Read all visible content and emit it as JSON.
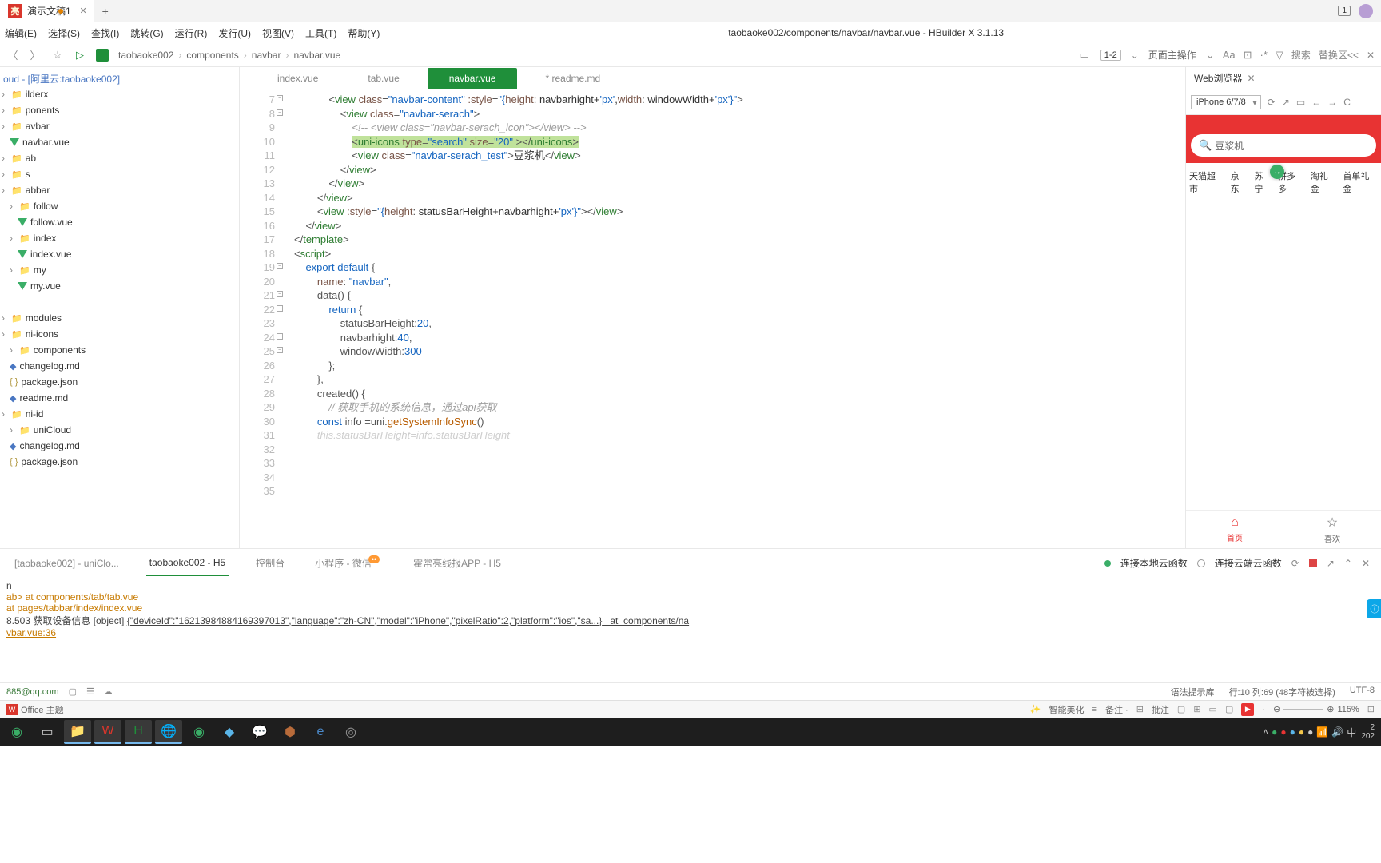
{
  "browser": {
    "tab_label": "演示文稿1",
    "tab_count": "1"
  },
  "menus": [
    "编辑(E)",
    "选择(S)",
    "查找(I)",
    "跳转(G)",
    "运行(R)",
    "发行(U)",
    "视图(V)",
    "工具(T)",
    "帮助(Y)"
  ],
  "window_title": "taobaoke002/components/navbar/navbar.vue - HBuilder X 3.1.13",
  "toolbar": {
    "ln_range": "1-2",
    "page_action": "页面主操作",
    "search_label": "搜索",
    "replace_label": "替换区<<"
  },
  "breadcrumbs": [
    "taobaoke002",
    "components",
    "navbar",
    "navbar.vue"
  ],
  "sidebar": {
    "project_suffix": "oud - [阿里云:taobaoke002]",
    "items": [
      {
        "pad": 0,
        "type": "folder",
        "label": "ilderx"
      },
      {
        "pad": 0,
        "type": "folder",
        "label": "ponents"
      },
      {
        "pad": 0,
        "type": "folder",
        "label": "avbar"
      },
      {
        "pad": 10,
        "type": "vue",
        "label": "navbar.vue"
      },
      {
        "pad": 0,
        "type": "folder",
        "label": "ab"
      },
      {
        "pad": 0,
        "type": "folder",
        "label": "s"
      },
      {
        "pad": 0,
        "type": "folder",
        "label": "abbar"
      },
      {
        "pad": 10,
        "type": "folder",
        "label": "follow"
      },
      {
        "pad": 20,
        "type": "vue",
        "label": "follow.vue"
      },
      {
        "pad": 10,
        "type": "folder",
        "label": "index"
      },
      {
        "pad": 20,
        "type": "vue",
        "label": "index.vue"
      },
      {
        "pad": 10,
        "type": "folder",
        "label": "my"
      },
      {
        "pad": 20,
        "type": "vue",
        "label": "my.vue"
      },
      {
        "pad": 0,
        "type": "blank",
        "label": ""
      },
      {
        "pad": 0,
        "type": "folder",
        "label": "modules"
      },
      {
        "pad": 0,
        "type": "folder",
        "label": "ni-icons"
      },
      {
        "pad": 10,
        "type": "folder",
        "label": "components"
      },
      {
        "pad": 10,
        "type": "md",
        "label": "changelog.md"
      },
      {
        "pad": 10,
        "type": "json",
        "label": "package.json"
      },
      {
        "pad": 10,
        "type": "md",
        "label": "readme.md"
      },
      {
        "pad": 0,
        "type": "folder",
        "label": "ni-id"
      },
      {
        "pad": 10,
        "type": "folder",
        "label": "uniCloud"
      },
      {
        "pad": 10,
        "type": "md",
        "label": "changelog.md"
      },
      {
        "pad": 10,
        "type": "json",
        "label": "package.json"
      }
    ]
  },
  "file_tabs": [
    {
      "label": "index.vue",
      "active": false
    },
    {
      "label": "tab.vue",
      "active": false
    },
    {
      "label": "navbar.vue",
      "active": true
    },
    {
      "label": "readme.md",
      "active": false,
      "modified": true
    }
  ],
  "code_lines": [
    {
      "n": 7,
      "fold": true,
      "indent": 6,
      "html": "<span class='c-punc'>&lt;</span><span class='c-tag'>view</span> <span class='c-attr'>class</span><span class='c-punc'>=</span><span class='c-str'>\"navbar-content\"</span> <span class='c-attr'>:style</span><span class='c-punc'>=</span><span class='c-str'>\"{</span><span class='c-attr'>height</span><span class='c-punc'>:</span> navbarhight+<span class='c-str'>'px'</span>,<span class='c-attr'>width</span><span class='c-punc'>:</span> windowWidth+<span class='c-str'>'px'</span><span class='c-str'>}\"</span><span class='c-punc'>&gt;</span>"
    },
    {
      "n": 8,
      "fold": true,
      "indent": 8,
      "html": "<span class='c-punc'>&lt;</span><span class='c-tag'>view</span> <span class='c-attr'>class</span><span class='c-punc'>=</span><span class='c-str'>\"navbar-serach\"</span><span class='c-punc'>&gt;</span>"
    },
    {
      "n": 9,
      "indent": 10,
      "html": "<span class='c-comment'>&lt;!-- &lt;view class=\"navbar-serach_icon\"&gt;&lt;/view&gt; --&gt;</span>"
    },
    {
      "n": 10,
      "indent": 10,
      "html": "<span class='hl'><span class='c-punc'>&lt;</span><span class='c-tag'>uni-icons</span> <span class='c-attr'>type</span><span class='c-punc'>=</span><span class='c-str'>\"search\"</span> <span class='c-attr'>size</span><span class='c-punc'>=</span><span class='c-str'>\"20\"</span> <span class='c-punc'>&gt;&lt;/</span><span class='c-tag'>uni-icons</span><span class='c-punc'>&gt;</span></span>"
    },
    {
      "n": 11,
      "indent": 10,
      "html": "<span class='c-punc'>&lt;</span><span class='c-tag'>view</span> <span class='c-attr'>class</span><span class='c-punc'>=</span><span class='c-str'>\"navbar-serach_test\"</span><span class='c-punc'>&gt;</span><span class='c-text'>豆浆机</span><span class='c-punc'>&lt;/</span><span class='c-tag'>view</span><span class='c-punc'>&gt;</span>"
    },
    {
      "n": 12,
      "indent": 8,
      "html": "<span class='c-punc'>&lt;/</span><span class='c-tag'>view</span><span class='c-punc'>&gt;</span>"
    },
    {
      "n": 13,
      "indent": 6,
      "html": "<span class='c-punc'>&lt;/</span><span class='c-tag'>view</span><span class='c-punc'>&gt;</span>"
    },
    {
      "n": 14,
      "indent": 0,
      "html": ""
    },
    {
      "n": 15,
      "indent": 4,
      "html": "<span class='c-punc'>&lt;/</span><span class='c-tag'>view</span><span class='c-punc'>&gt;</span>"
    },
    {
      "n": 16,
      "indent": 4,
      "html": "<span class='c-punc'>&lt;</span><span class='c-tag'>view</span> <span class='c-attr'>:style</span><span class='c-punc'>=</span><span class='c-str'>\"{</span><span class='c-attr'>height</span><span class='c-punc'>:</span> statusBarHeight+navbarhight+<span class='c-str'>'px'</span><span class='c-str'>}\"</span><span class='c-punc'>&gt;&lt;/</span><span class='c-tag'>view</span><span class='c-punc'>&gt;</span>"
    },
    {
      "n": 17,
      "indent": 0,
      "html": ""
    },
    {
      "n": 18,
      "indent": 2,
      "html": "<span class='c-punc'>&lt;/</span><span class='c-tag'>view</span><span class='c-punc'>&gt;</span>"
    },
    {
      "n": 19,
      "fold": true,
      "indent": 0,
      "html": "<span class='c-punc'>&lt;/</span><span class='c-tag'>template</span><span class='c-punc'>&gt;</span>"
    },
    {
      "n": 20,
      "indent": 0,
      "html": ""
    },
    {
      "n": 21,
      "fold": true,
      "indent": 0,
      "html": "<span class='c-punc'>&lt;</span><span class='c-tag'>script</span><span class='c-punc'>&gt;</span>"
    },
    {
      "n": 22,
      "fold": true,
      "indent": 2,
      "html": "<span class='c-kw'>export</span> <span class='c-kw'>default</span> <span class='c-punc'>{</span>"
    },
    {
      "n": 23,
      "indent": 4,
      "html": "<span class='c-attr'>name</span><span class='c-punc'>:</span> <span class='c-str'>\"navbar\"</span><span class='c-punc'>,</span>"
    },
    {
      "n": 24,
      "fold": true,
      "indent": 4,
      "html": "<span class='c-name'>data</span><span class='c-punc'>() {</span>"
    },
    {
      "n": 25,
      "fold": true,
      "indent": 6,
      "html": "<span class='c-kw'>return</span> <span class='c-punc'>{</span>"
    },
    {
      "n": 26,
      "indent": 8,
      "html": "<span class='c-name'>statusBarHeight</span><span class='c-punc'>:</span><span class='c-num'>20</span><span class='c-punc'>,</span>"
    },
    {
      "n": 27,
      "indent": 8,
      "html": "<span class='c-name'>navbarhight</span><span class='c-punc'>:</span><span class='c-num'>40</span><span class='c-punc'>,</span>"
    },
    {
      "n": 28,
      "indent": 8,
      "html": "<span class='c-name'>windowWidth</span><span class='c-punc'>:</span><span class='c-num'>300</span>"
    },
    {
      "n": 29,
      "indent": 0,
      "html": ""
    },
    {
      "n": 30,
      "indent": 6,
      "html": "<span class='c-punc'>};</span>"
    },
    {
      "n": 31,
      "indent": 4,
      "html": "<span class='c-punc'>},</span>"
    },
    {
      "n": 32,
      "indent": 4,
      "html": "<span class='c-name'>created</span><span class='c-punc'>() {</span>"
    },
    {
      "n": 33,
      "indent": 6,
      "html": "<span class='c-comment'>// 获取手机的系统信息，通过api获取</span>"
    },
    {
      "n": 34,
      "indent": 4,
      "html": "<span class='c-kw'>const</span> <span class='c-name'>info</span> <span class='c-punc'>=</span><span class='c-name'>uni</span><span class='c-punc'>.</span><span class='c-method'>getSystemInfoSync</span><span class='c-punc'>()</span>"
    },
    {
      "n": 35,
      "indent": 4,
      "html": "<span class='c-comment' style='opacity:.5'>this.statusBarHeight=info.statusBarHeight</span>"
    }
  ],
  "right_panel": {
    "title": "Web浏览器",
    "device": "iPhone 6/7/8",
    "search_placeholder": "豆浆机",
    "categories": [
      "天猫超市",
      "京东",
      "苏宁",
      "拼多多",
      "淘礼金",
      "首单礼金"
    ],
    "tab_home": "首页",
    "tab_fav": "喜欢"
  },
  "console_tabs": {
    "t1": "[taobaoke002] - uniClo...",
    "t2": "taobaoke002 - H5",
    "t3": "控制台",
    "t4": "小程序 - 微信",
    "t5": "霍常亮线报APP - H5",
    "local": "连接本地云函数",
    "remote": "连接云端云函数"
  },
  "console": {
    "l1": "n",
    "l2": "ab> at components/tab/tab.vue",
    "l3": "at pages/tabbar/index/index.vue",
    "l4_pre": "8.503 获取设备信息 [object] ",
    "l4_obj": "{\"deviceId\":\"16213984884169397013\",\"language\":\"zh-CN\",\"model\":\"iPhone\",\"pixelRatio\":2,\"platform\":\"ios\",\"sa...}",
    "l4_post": "   at  components/na",
    "l5": "vbar.vue:36"
  },
  "status": {
    "mail": "885@qq.com",
    "lib": "语法提示库",
    "pos": "行:10  列:69 (48字符被选择)",
    "enc": "UTF-8"
  },
  "office": {
    "label": "Office 主题",
    "beautify": "智能美化",
    "note": "备注 ·",
    "approve": "批注",
    "zoom": "115%"
  },
  "taskbar": {
    "time1": "2",
    "time2": "202",
    "ime": "中"
  }
}
